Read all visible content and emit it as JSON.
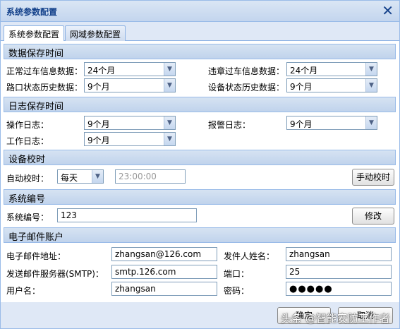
{
  "window": {
    "title": "系统参数配置",
    "close_glyph": "✕"
  },
  "tabs": [
    {
      "label": "系统参数配置",
      "active": true
    },
    {
      "label": "网域参数配置",
      "active": false
    }
  ],
  "data_retention": {
    "header": "数据保存时间",
    "normal_pass_label": "正常过车信息数据：",
    "normal_pass_value": "24个月",
    "violation_pass_label": "违章过车信息数据：",
    "violation_pass_value": "24个月",
    "intersection_history_label": "路口状态历史数据：",
    "intersection_history_value": "9个月",
    "device_history_label": "设备状态历史数据：",
    "device_history_value": "9个月"
  },
  "log_retention": {
    "header": "日志保存时间",
    "operation_log_label": "操作日志：",
    "operation_log_value": "9个月",
    "alarm_log_label": "报警日志：",
    "alarm_log_value": "9个月",
    "work_log_label": "工作日志：",
    "work_log_value": "9个月"
  },
  "device_sync": {
    "header": "设备校时",
    "auto_sync_label": "自动校时：",
    "auto_sync_value": "每天",
    "auto_sync_time": "23:00:00",
    "manual_sync_button": "手动校时"
  },
  "system_number": {
    "header": "系统编号",
    "number_label": "系统编号：",
    "number_value": "123",
    "modify_button": "修改"
  },
  "email_account": {
    "header": "电子邮件账户",
    "email_label": "电子邮件地址：",
    "email_value": "zhangsan@126.com",
    "sender_label": "发件人姓名：",
    "sender_value": "zhangsan",
    "smtp_label": "发送邮件服务器(SMTP)：",
    "smtp_value": "smtp.126.com",
    "port_label": "端口：",
    "port_value": "25",
    "username_label": "用户名：",
    "username_value": "zhangsan",
    "password_label": "密码：",
    "password_value": "●●●●●"
  },
  "footer": {
    "ok_button": "确定",
    "cancel_button": "取消"
  },
  "watermark": "头条 @智能安防工作者",
  "icons": {
    "dropdown_arrow": "▼"
  },
  "colors": {
    "header_bg": "#c9d9ee",
    "border": "#99bbe8",
    "title_text": "#15428b"
  }
}
